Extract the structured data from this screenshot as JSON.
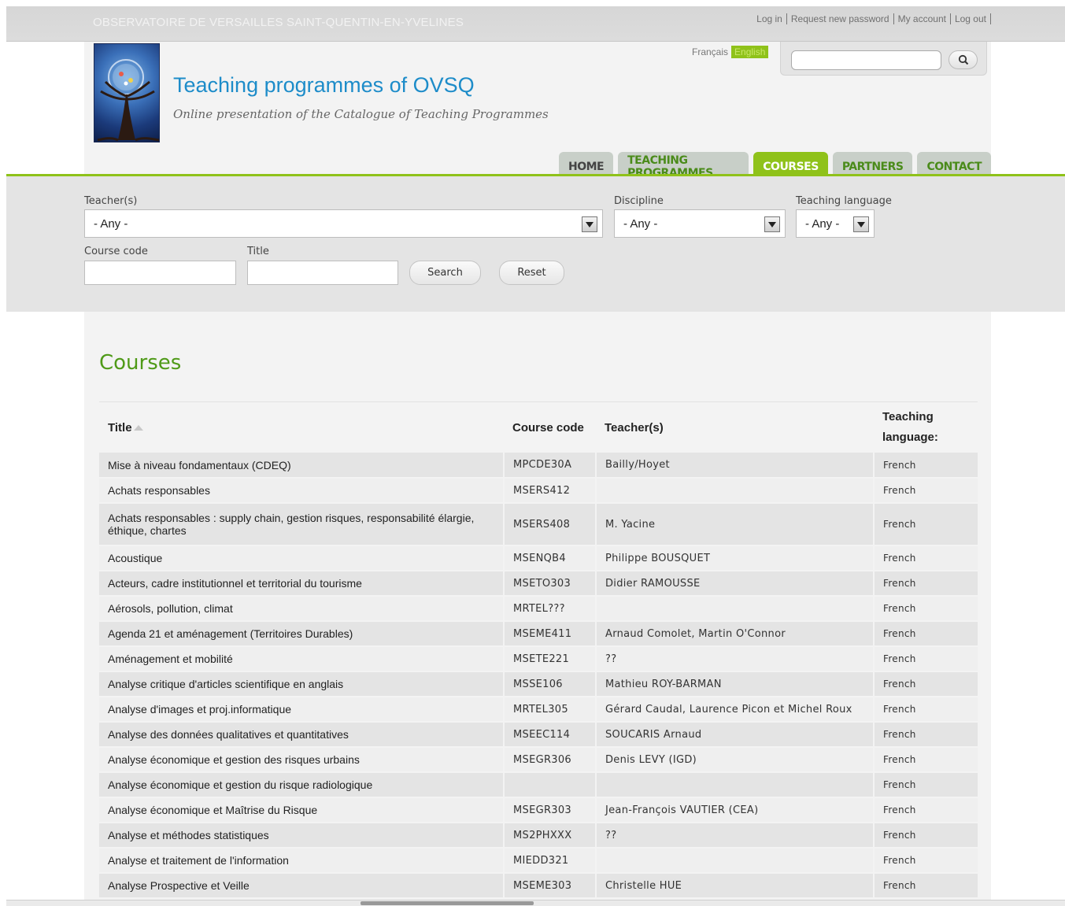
{
  "topbar": {
    "site_name": "OBSERVATOIRE DE VERSAILLES SAINT-QUENTIN-EN-YVELINES",
    "links": [
      "Log in",
      "Request new password",
      "My account",
      "Log out"
    ]
  },
  "header": {
    "title": "Teaching programmes of OVSQ",
    "slogan": "Online presentation of the Catalogue of Teaching Programmes",
    "languages": [
      "Français",
      "English"
    ],
    "search_icon": "search-icon"
  },
  "nav": {
    "tabs": [
      "HOME",
      "TEACHING PROGRAMMES",
      "COURSES",
      "PARTNERS",
      "CONTACT"
    ],
    "active": "COURSES"
  },
  "filters": {
    "teacher_label": "Teacher(s)",
    "teacher_value": "- Any -",
    "discipline_label": "Discipline",
    "discipline_value": "- Any -",
    "language_label": "Teaching language",
    "language_value": "- Any -",
    "code_label": "Course code",
    "title_label": "Title",
    "search_button": "Search",
    "reset_button": "Reset"
  },
  "main": {
    "page_title": "Courses",
    "columns": [
      "Title",
      "Course code",
      "Teacher(s)",
      "Teaching language:"
    ],
    "rows": [
      [
        "Mise à niveau fondamentaux (CDEQ)",
        "MPCDE30A",
        "Bailly/Hoyet",
        "French"
      ],
      [
        "Achats responsables",
        "MSERS412",
        "",
        "French"
      ],
      [
        "Achats responsables : supply chain, gestion risques, responsabilité élargie, éthique, chartes",
        "MSERS408",
        "M. Yacine",
        "French"
      ],
      [
        "Acoustique",
        "MSENQB4",
        "Philippe BOUSQUET",
        "French"
      ],
      [
        "Acteurs, cadre institutionnel et territorial du tourisme",
        "MSETO303",
        "Didier RAMOUSSE",
        "French"
      ],
      [
        "Aérosols, pollution, climat",
        "MRTEL???",
        "",
        "French"
      ],
      [
        "Agenda 21 et aménagement (Territoires Durables)",
        "MSEME411",
        "Arnaud Comolet, Martin O'Connor",
        "French"
      ],
      [
        "Aménagement et mobilité",
        "MSETE221",
        "??",
        "French"
      ],
      [
        "Analyse critique d'articles scientifique en anglais",
        "MSSE106",
        "Mathieu ROY-BARMAN",
        "French"
      ],
      [
        "Analyse d'images et proj.informatique",
        "MRTEL305",
        "Gérard Caudal, Laurence Picon et Michel Roux",
        "French"
      ],
      [
        "Analyse des données qualitatives et quantitatives",
        "MSEEC114",
        "SOUCARIS Arnaud",
        "French"
      ],
      [
        "Analyse économique et gestion des risques urbains",
        "MSEGR306",
        "Denis LEVY (IGD)",
        "French"
      ],
      [
        "Analyse économique et gestion du risque radiologique",
        "",
        "",
        "French"
      ],
      [
        "Analyse économique et Maîtrise du Risque",
        "MSEGR303",
        "Jean-François VAUTIER (CEA)",
        "French"
      ],
      [
        "Analyse et méthodes statistiques",
        "MS2PHXXX",
        "??",
        "French"
      ],
      [
        "Analyse et traitement de l'information",
        "MIEDD321",
        "",
        "French"
      ],
      [
        "Analyse Prospective et Veille",
        "MSEME303",
        "Christelle HUE",
        "French"
      ]
    ]
  }
}
